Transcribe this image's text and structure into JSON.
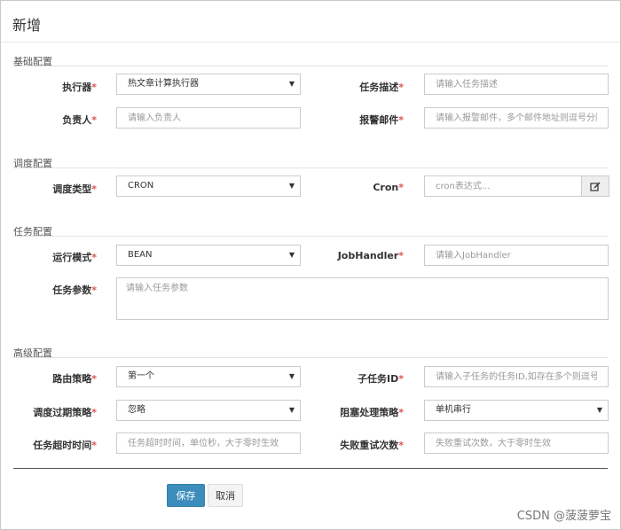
{
  "dialog": {
    "title": "新增"
  },
  "sections": {
    "basic": "基础配置",
    "schedule": "调度配置",
    "task": "任务配置",
    "advanced": "高级配置"
  },
  "required_mark": "*",
  "fields": {
    "executor": {
      "label": "执行器",
      "value": "热文章计算执行器"
    },
    "task_desc": {
      "label": "任务描述",
      "placeholder": "请输入任务描述"
    },
    "owner": {
      "label": "负责人",
      "placeholder": "请输入负责人"
    },
    "alarm_email": {
      "label": "报警邮件",
      "placeholder": "请输入报警邮件，多个邮件地址则逗号分隔"
    },
    "schedule_type": {
      "label": "调度类型",
      "value": "CRON"
    },
    "cron": {
      "label": "Cron",
      "placeholder": "cron表达式..."
    },
    "run_mode": {
      "label": "运行模式",
      "value": "BEAN"
    },
    "job_handler": {
      "label": "JobHandler",
      "placeholder": "请输入JobHandler"
    },
    "task_param": {
      "label": "任务参数",
      "placeholder": "请输入任务参数"
    },
    "route_strategy": {
      "label": "路由策略",
      "value": "第一个"
    },
    "child_job_id": {
      "label": "子任务ID",
      "placeholder": "请输入子任务的任务ID,如存在多个则逗号分隔"
    },
    "misfire": {
      "label": "调度过期策略",
      "value": "忽略"
    },
    "block_strategy": {
      "label": "阻塞处理策略",
      "value": "单机串行"
    },
    "timeout": {
      "label": "任务超时时间",
      "placeholder": "任务超时时间，单位秒，大于零时生效"
    },
    "retry": {
      "label": "失败重试次数",
      "placeholder": "失败重试次数，大于零时生效"
    }
  },
  "buttons": {
    "save": "保存",
    "cancel": "取消"
  },
  "watermark": "CSDN @菠菠萝宝",
  "colors": {
    "primary": "#3c8dbc",
    "required": "#d9534f"
  }
}
